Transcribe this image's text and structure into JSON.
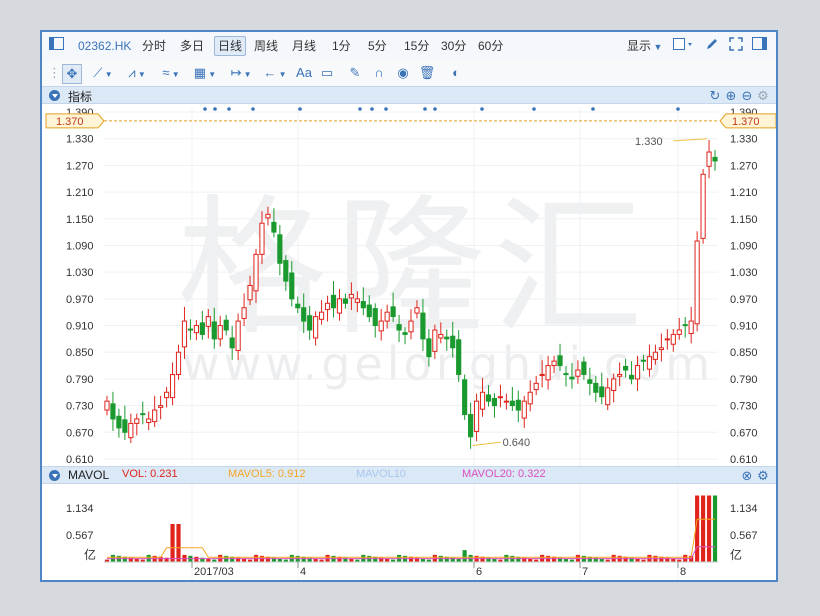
{
  "toolbar": {
    "symbol": "02362.HK",
    "periods": [
      "分时",
      "多日",
      "日线",
      "周线",
      "月线",
      "1分",
      "5分",
      "15分",
      "30分",
      "60分"
    ],
    "active_period": "日线",
    "display_label": "显示"
  },
  "indicator_header": {
    "title": "指标"
  },
  "price_marker": "1.370",
  "annotations": {
    "high": "1.330",
    "low": "0.640"
  },
  "volume_header": {
    "title": "MAVOL",
    "vol_label": "VOL: 0.231",
    "mavol5_label": "MAVOL5: 0.912",
    "mavol10_label": "MAVOL10",
    "mavol20_label": "MAVOL20: 0.322"
  },
  "volume_unit": "亿",
  "watermark": {
    "main": "格隆汇",
    "url": "www.gelonghui.com"
  },
  "colors": {
    "up": "#e0241c",
    "down": "#1a9a2e",
    "accent": "#3b73b9",
    "mavol5": "#f5a623",
    "mavol10": "#a8c8f0",
    "mavol20": "#d94fc0"
  },
  "chart_data": [
    {
      "type": "candlestick",
      "y_ticks": [
        "1.390",
        "1.330",
        "1.270",
        "1.210",
        "1.150",
        "1.090",
        "1.030",
        "0.970",
        "0.910",
        "0.850",
        "0.790",
        "0.730",
        "0.670",
        "0.610"
      ],
      "ylim": [
        0.61,
        1.39
      ],
      "x_tick_labels": [
        "2017/03",
        "4",
        "6",
        "7",
        "8"
      ],
      "close_series": [
        0.74,
        0.7,
        0.68,
        0.67,
        0.69,
        0.7,
        0.71,
        0.7,
        0.72,
        0.73,
        0.76,
        0.8,
        0.85,
        0.92,
        0.9,
        0.91,
        0.89,
        0.93,
        0.88,
        0.91,
        0.9,
        0.86,
        0.92,
        0.95,
        1.0,
        1.07,
        1.14,
        1.16,
        1.12,
        1.05,
        1.01,
        0.97,
        0.95,
        0.92,
        0.9,
        0.93,
        0.94,
        0.96,
        0.95,
        0.97,
        0.96,
        0.98,
        0.97,
        0.95,
        0.93,
        0.91,
        0.92,
        0.94,
        0.93,
        0.9,
        0.89,
        0.92,
        0.95,
        0.88,
        0.84,
        0.9,
        0.89,
        0.88,
        0.86,
        0.8,
        0.71,
        0.66,
        0.74,
        0.76,
        0.74,
        0.73,
        0.75,
        0.74,
        0.73,
        0.72,
        0.74,
        0.76,
        0.78,
        0.8,
        0.82,
        0.83,
        0.82,
        0.8,
        0.79,
        0.81,
        0.8,
        0.78,
        0.76,
        0.75,
        0.77,
        0.79,
        0.8,
        0.81,
        0.79,
        0.82,
        0.83,
        0.84,
        0.85,
        0.86,
        0.88,
        0.89,
        0.9,
        0.91,
        0.92,
        1.1,
        1.25,
        1.3,
        1.28
      ],
      "volume_ticks": [
        "1.134",
        "0.567"
      ],
      "volume_ylim": [
        0,
        1.6
      ]
    }
  ]
}
